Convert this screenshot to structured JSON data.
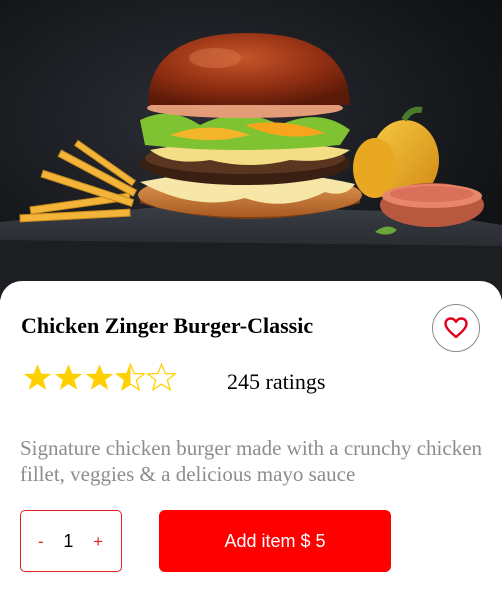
{
  "product": {
    "name": "Chicken Zinger Burger-Classic",
    "image_subject": "burger-photo",
    "rating": 3.5,
    "rating_max": 5,
    "ratings_count_label": "245 ratings",
    "description": "Signature chicken burger made with a crunchy chicken fillet, veggies & a delicious mayo sauce"
  },
  "actions": {
    "favorite_icon": "heart-icon",
    "quantity": {
      "decrement_label": "-",
      "value": "1",
      "increment_label": "+"
    },
    "add_label": "Add item $ 5"
  },
  "colors": {
    "accent": "#fe0000",
    "star": "#ffd000",
    "heart": "#e0001b",
    "description_text": "#8d8d8d"
  }
}
